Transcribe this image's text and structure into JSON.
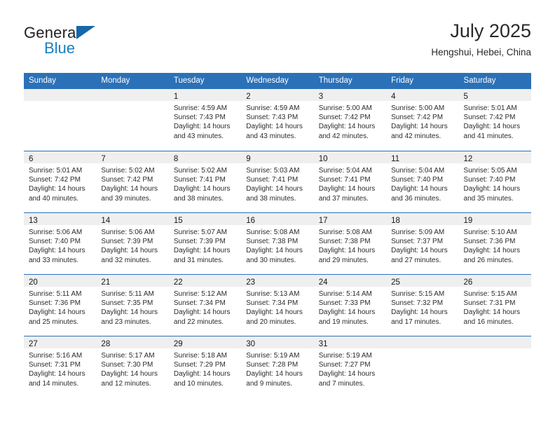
{
  "logo": {
    "word_top": "General",
    "word_bottom": "Blue",
    "triangle_icon": "triangle-icon",
    "color_dark": "#231f20",
    "color_blue": "#1a7fc1",
    "color_triangle": "#1767ab"
  },
  "header": {
    "title": "July 2025",
    "location": "Hengshui, Hebei, China"
  },
  "theme": {
    "header_bg": "#2b71b8",
    "header_text": "#ffffff",
    "daynum_strip_bg": "#efefef",
    "row_divider": "#2b71b8"
  },
  "weekday_headers": [
    "Sunday",
    "Monday",
    "Tuesday",
    "Wednesday",
    "Thursday",
    "Friday",
    "Saturday"
  ],
  "weeks": [
    [
      {
        "day": "",
        "sunrise": "",
        "sunset": "",
        "daylight_a": "",
        "daylight_b": ""
      },
      {
        "day": "",
        "sunrise": "",
        "sunset": "",
        "daylight_a": "",
        "daylight_b": ""
      },
      {
        "day": "1",
        "sunrise": "Sunrise: 4:59 AM",
        "sunset": "Sunset: 7:43 PM",
        "daylight_a": "Daylight: 14 hours",
        "daylight_b": "and 43 minutes."
      },
      {
        "day": "2",
        "sunrise": "Sunrise: 4:59 AM",
        "sunset": "Sunset: 7:43 PM",
        "daylight_a": "Daylight: 14 hours",
        "daylight_b": "and 43 minutes."
      },
      {
        "day": "3",
        "sunrise": "Sunrise: 5:00 AM",
        "sunset": "Sunset: 7:42 PM",
        "daylight_a": "Daylight: 14 hours",
        "daylight_b": "and 42 minutes."
      },
      {
        "day": "4",
        "sunrise": "Sunrise: 5:00 AM",
        "sunset": "Sunset: 7:42 PM",
        "daylight_a": "Daylight: 14 hours",
        "daylight_b": "and 42 minutes."
      },
      {
        "day": "5",
        "sunrise": "Sunrise: 5:01 AM",
        "sunset": "Sunset: 7:42 PM",
        "daylight_a": "Daylight: 14 hours",
        "daylight_b": "and 41 minutes."
      }
    ],
    [
      {
        "day": "6",
        "sunrise": "Sunrise: 5:01 AM",
        "sunset": "Sunset: 7:42 PM",
        "daylight_a": "Daylight: 14 hours",
        "daylight_b": "and 40 minutes."
      },
      {
        "day": "7",
        "sunrise": "Sunrise: 5:02 AM",
        "sunset": "Sunset: 7:42 PM",
        "daylight_a": "Daylight: 14 hours",
        "daylight_b": "and 39 minutes."
      },
      {
        "day": "8",
        "sunrise": "Sunrise: 5:02 AM",
        "sunset": "Sunset: 7:41 PM",
        "daylight_a": "Daylight: 14 hours",
        "daylight_b": "and 38 minutes."
      },
      {
        "day": "9",
        "sunrise": "Sunrise: 5:03 AM",
        "sunset": "Sunset: 7:41 PM",
        "daylight_a": "Daylight: 14 hours",
        "daylight_b": "and 38 minutes."
      },
      {
        "day": "10",
        "sunrise": "Sunrise: 5:04 AM",
        "sunset": "Sunset: 7:41 PM",
        "daylight_a": "Daylight: 14 hours",
        "daylight_b": "and 37 minutes."
      },
      {
        "day": "11",
        "sunrise": "Sunrise: 5:04 AM",
        "sunset": "Sunset: 7:40 PM",
        "daylight_a": "Daylight: 14 hours",
        "daylight_b": "and 36 minutes."
      },
      {
        "day": "12",
        "sunrise": "Sunrise: 5:05 AM",
        "sunset": "Sunset: 7:40 PM",
        "daylight_a": "Daylight: 14 hours",
        "daylight_b": "and 35 minutes."
      }
    ],
    [
      {
        "day": "13",
        "sunrise": "Sunrise: 5:06 AM",
        "sunset": "Sunset: 7:40 PM",
        "daylight_a": "Daylight: 14 hours",
        "daylight_b": "and 33 minutes."
      },
      {
        "day": "14",
        "sunrise": "Sunrise: 5:06 AM",
        "sunset": "Sunset: 7:39 PM",
        "daylight_a": "Daylight: 14 hours",
        "daylight_b": "and 32 minutes."
      },
      {
        "day": "15",
        "sunrise": "Sunrise: 5:07 AM",
        "sunset": "Sunset: 7:39 PM",
        "daylight_a": "Daylight: 14 hours",
        "daylight_b": "and 31 minutes."
      },
      {
        "day": "16",
        "sunrise": "Sunrise: 5:08 AM",
        "sunset": "Sunset: 7:38 PM",
        "daylight_a": "Daylight: 14 hours",
        "daylight_b": "and 30 minutes."
      },
      {
        "day": "17",
        "sunrise": "Sunrise: 5:08 AM",
        "sunset": "Sunset: 7:38 PM",
        "daylight_a": "Daylight: 14 hours",
        "daylight_b": "and 29 minutes."
      },
      {
        "day": "18",
        "sunrise": "Sunrise: 5:09 AM",
        "sunset": "Sunset: 7:37 PM",
        "daylight_a": "Daylight: 14 hours",
        "daylight_b": "and 27 minutes."
      },
      {
        "day": "19",
        "sunrise": "Sunrise: 5:10 AM",
        "sunset": "Sunset: 7:36 PM",
        "daylight_a": "Daylight: 14 hours",
        "daylight_b": "and 26 minutes."
      }
    ],
    [
      {
        "day": "20",
        "sunrise": "Sunrise: 5:11 AM",
        "sunset": "Sunset: 7:36 PM",
        "daylight_a": "Daylight: 14 hours",
        "daylight_b": "and 25 minutes."
      },
      {
        "day": "21",
        "sunrise": "Sunrise: 5:11 AM",
        "sunset": "Sunset: 7:35 PM",
        "daylight_a": "Daylight: 14 hours",
        "daylight_b": "and 23 minutes."
      },
      {
        "day": "22",
        "sunrise": "Sunrise: 5:12 AM",
        "sunset": "Sunset: 7:34 PM",
        "daylight_a": "Daylight: 14 hours",
        "daylight_b": "and 22 minutes."
      },
      {
        "day": "23",
        "sunrise": "Sunrise: 5:13 AM",
        "sunset": "Sunset: 7:34 PM",
        "daylight_a": "Daylight: 14 hours",
        "daylight_b": "and 20 minutes."
      },
      {
        "day": "24",
        "sunrise": "Sunrise: 5:14 AM",
        "sunset": "Sunset: 7:33 PM",
        "daylight_a": "Daylight: 14 hours",
        "daylight_b": "and 19 minutes."
      },
      {
        "day": "25",
        "sunrise": "Sunrise: 5:15 AM",
        "sunset": "Sunset: 7:32 PM",
        "daylight_a": "Daylight: 14 hours",
        "daylight_b": "and 17 minutes."
      },
      {
        "day": "26",
        "sunrise": "Sunrise: 5:15 AM",
        "sunset": "Sunset: 7:31 PM",
        "daylight_a": "Daylight: 14 hours",
        "daylight_b": "and 16 minutes."
      }
    ],
    [
      {
        "day": "27",
        "sunrise": "Sunrise: 5:16 AM",
        "sunset": "Sunset: 7:31 PM",
        "daylight_a": "Daylight: 14 hours",
        "daylight_b": "and 14 minutes."
      },
      {
        "day": "28",
        "sunrise": "Sunrise: 5:17 AM",
        "sunset": "Sunset: 7:30 PM",
        "daylight_a": "Daylight: 14 hours",
        "daylight_b": "and 12 minutes."
      },
      {
        "day": "29",
        "sunrise": "Sunrise: 5:18 AM",
        "sunset": "Sunset: 7:29 PM",
        "daylight_a": "Daylight: 14 hours",
        "daylight_b": "and 10 minutes."
      },
      {
        "day": "30",
        "sunrise": "Sunrise: 5:19 AM",
        "sunset": "Sunset: 7:28 PM",
        "daylight_a": "Daylight: 14 hours",
        "daylight_b": "and 9 minutes."
      },
      {
        "day": "31",
        "sunrise": "Sunrise: 5:19 AM",
        "sunset": "Sunset: 7:27 PM",
        "daylight_a": "Daylight: 14 hours",
        "daylight_b": "and 7 minutes."
      },
      {
        "day": "",
        "sunrise": "",
        "sunset": "",
        "daylight_a": "",
        "daylight_b": ""
      },
      {
        "day": "",
        "sunrise": "",
        "sunset": "",
        "daylight_a": "",
        "daylight_b": ""
      }
    ]
  ]
}
